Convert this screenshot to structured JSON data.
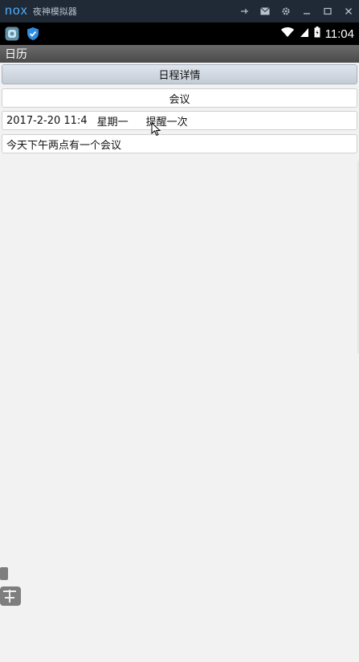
{
  "emulator": {
    "logo": "nox",
    "title": "夜神模拟器",
    "controls": [
      "pin-icon",
      "mail-icon",
      "gear-icon",
      "minimize-icon",
      "maximize-icon",
      "close-icon"
    ]
  },
  "status_bar": {
    "time": "11:04",
    "icons": [
      "app-icon",
      "shield-icon",
      "wifi-icon",
      "signal-icon",
      "battery-icon"
    ]
  },
  "action_bar": {
    "title": "日历"
  },
  "detail": {
    "header": "日程详情",
    "event_title": "会议",
    "datetime": "2017-2-20 11:4",
    "weekday": "星期一",
    "remind": "提醒一次",
    "description": "今天下午两点有一个会议"
  },
  "colors": {
    "emulator_bar": "#1f2a36",
    "status_bar": "#000000",
    "action_bar": "#555555",
    "background": "#f2f2f2"
  }
}
